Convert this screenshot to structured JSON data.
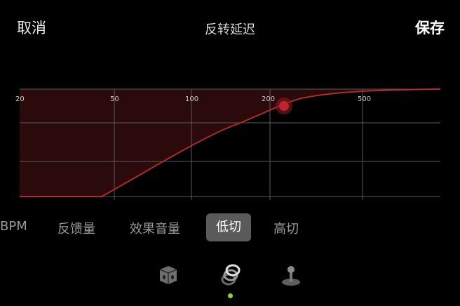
{
  "header": {
    "cancel_label": "取消",
    "title": "反转延迟",
    "save_label": "保存"
  },
  "graph": {
    "x_ticks": [
      "20",
      "50",
      "100",
      "200",
      "500"
    ],
    "curve_color": "#b22a2a",
    "fill_color": "#2a0a0a",
    "handle_color": "#c0242c"
  },
  "tabs": [
    {
      "label": "BPM",
      "active": false
    },
    {
      "label": "反馈量",
      "active": false
    },
    {
      "label": "效果音量",
      "active": false
    },
    {
      "label": "低切",
      "active": true
    },
    {
      "label": "高切",
      "active": false
    }
  ],
  "bottom_icons": [
    {
      "name": "dice-icon"
    },
    {
      "name": "rings-icon",
      "selected": true
    },
    {
      "name": "joystick-icon"
    }
  ],
  "colors": {
    "accent_dot": "#8fd13c",
    "active_tab_bg": "#5a5a5a"
  }
}
